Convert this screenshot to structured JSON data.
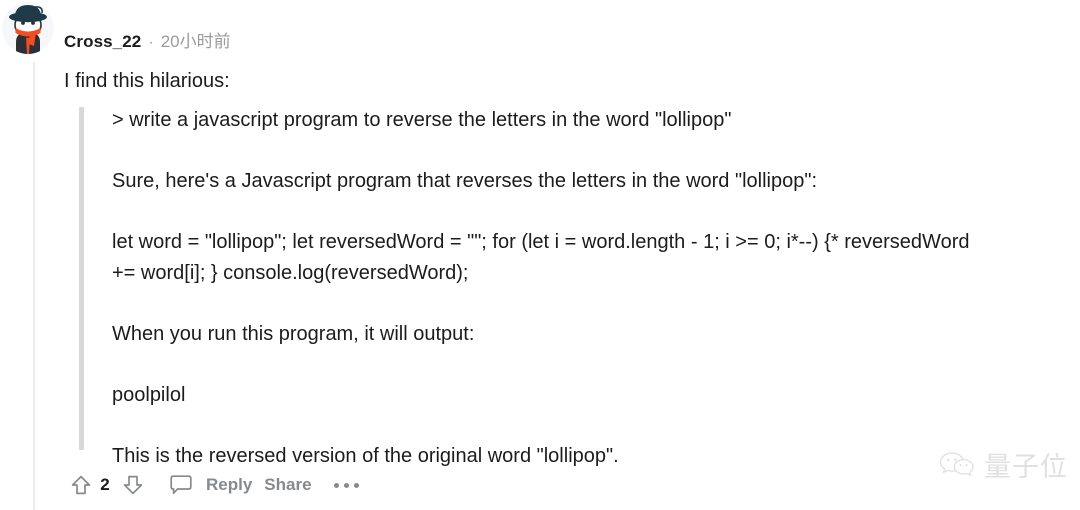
{
  "comment": {
    "author": "Cross_22",
    "separator": "·",
    "timestamp": "20小时前",
    "avatar_alt": "snoo-avatar",
    "lead_text": "I find this hilarious:",
    "quote_paragraphs": [
      "> write a javascript program to reverse the letters in the word \"lollipop\"",
      "Sure, here's a Javascript program that reverses the letters in the word \"lollipop\":",
      "let word = \"lollipop\"; let reversedWord = \"\"; for (let i = word.length - 1; i >= 0; i*--) {* reversedWord += word[i]; } console.log(reversedWord);",
      "When you run this program, it will output:",
      "poolpilol",
      "This is the reversed version of the original word \"lollipop\"."
    ]
  },
  "actions": {
    "upvote_label": "upvote",
    "score": "2",
    "downvote_label": "downvote",
    "comment_label": "comment",
    "reply_label": "Reply",
    "share_label": "Share",
    "more_label": "more options"
  },
  "watermark": {
    "text": "量子位",
    "icon": "wechat-icon"
  },
  "colors": {
    "text": "#1c1c1c",
    "muted": "#878a8c",
    "meta": "#9b9b9b",
    "quote_bar": "#d8d8d8",
    "thread_line": "#ededed",
    "background": "#ffffff",
    "avatar_orange": "#f14e24",
    "avatar_navy": "#1e3a47"
  }
}
